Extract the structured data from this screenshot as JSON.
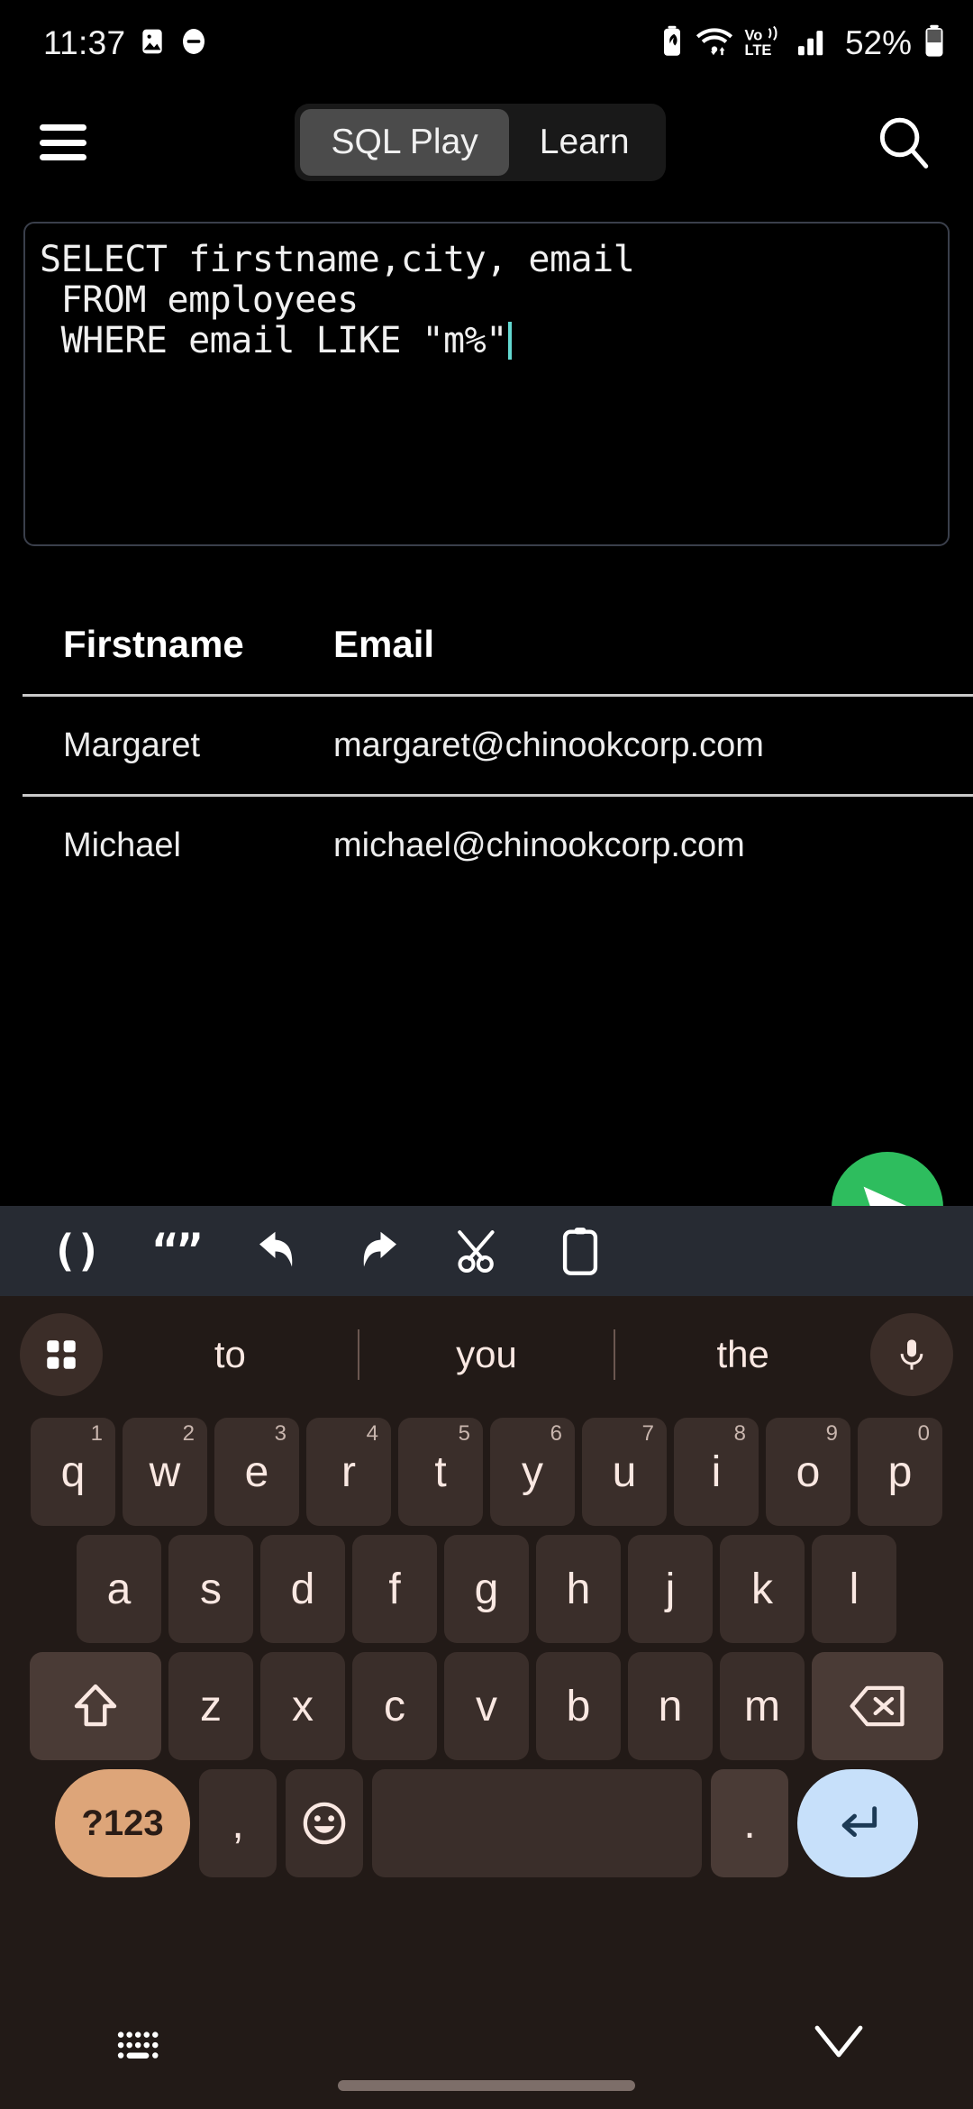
{
  "status_bar": {
    "time": "11:37",
    "battery_percent": "52%",
    "left_icons": [
      "image-icon",
      "do-not-disturb-icon"
    ],
    "right_icons": [
      "battery-saver-icon",
      "wifi-icon",
      "volte-icon",
      "signal-icon"
    ],
    "network_label": "Vo) LTE"
  },
  "top_nav": {
    "menu_icon": "hamburger-menu-icon",
    "search_icon": "search-icon",
    "tabs": [
      {
        "label": "SQL Play",
        "active": true
      },
      {
        "label": "Learn",
        "active": false
      }
    ]
  },
  "editor": {
    "line1": "SELECT firstname,city, email",
    "line2": " FROM employees",
    "line3": " WHERE email LIKE \"m%\"",
    "caret_color": "#63d8d0",
    "border_color": "#3a3f4b"
  },
  "results": {
    "columns": [
      "Firstname",
      "Email"
    ],
    "rows": [
      {
        "firstname": "Margaret",
        "email": "margaret@chinookcorp.com"
      },
      {
        "firstname": "Michael",
        "email": "michael@chinookcorp.com"
      }
    ]
  },
  "fab": {
    "icon": "send-icon",
    "color": "#2ebd5e"
  },
  "sql_toolbar": {
    "background": "#272b33",
    "buttons": [
      {
        "name": "parentheses-button",
        "label": "()"
      },
      {
        "name": "quotes-button",
        "label": "“”"
      },
      {
        "name": "undo-button",
        "label": ""
      },
      {
        "name": "redo-button",
        "label": ""
      },
      {
        "name": "cut-button",
        "label": ""
      },
      {
        "name": "paste-button",
        "label": ""
      }
    ]
  },
  "keyboard": {
    "background": "#221a17",
    "key_color": "#3a2e2a",
    "suggestions": [
      "to",
      "you",
      "the"
    ],
    "grid_icon": "grid-icon",
    "mic_icon": "microphone-icon",
    "row1": [
      {
        "key": "q",
        "num": "1"
      },
      {
        "key": "w",
        "num": "2"
      },
      {
        "key": "e",
        "num": "3"
      },
      {
        "key": "r",
        "num": "4"
      },
      {
        "key": "t",
        "num": "5"
      },
      {
        "key": "y",
        "num": "6"
      },
      {
        "key": "u",
        "num": "7"
      },
      {
        "key": "i",
        "num": "8"
      },
      {
        "key": "o",
        "num": "9"
      },
      {
        "key": "p",
        "num": "0"
      }
    ],
    "row2": [
      "a",
      "s",
      "d",
      "f",
      "g",
      "h",
      "j",
      "k",
      "l"
    ],
    "row3": [
      "z",
      "x",
      "c",
      "v",
      "b",
      "n",
      "m"
    ],
    "shift_icon": "shift-icon",
    "backspace_icon": "backspace-icon",
    "row4": {
      "symbols_label": "?123",
      "comma_label": ",",
      "emoji_icon": "emoji-icon",
      "space_label": "",
      "period_label": ".",
      "enter_icon": "enter-icon",
      "symbols_color": "#dda579",
      "enter_color": "#c7e0fa"
    }
  },
  "nav_bar": {
    "keyboard_switch_icon": "keyboard-switch-icon",
    "hide_keyboard_icon": "chevron-down-icon"
  }
}
